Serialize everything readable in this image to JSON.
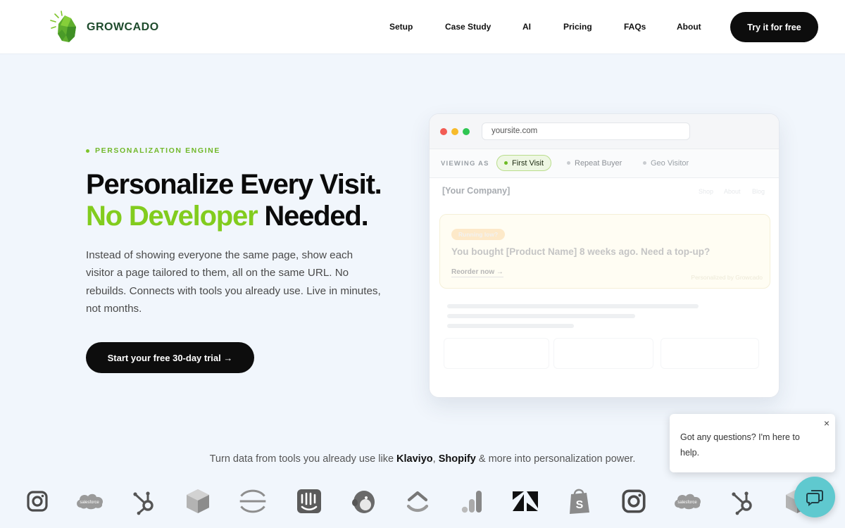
{
  "brand": {
    "name": "GROWCADO"
  },
  "nav": {
    "items": [
      "Setup",
      "Case Study",
      "AI",
      "Pricing",
      "FAQs",
      "About"
    ],
    "cta": "Try it for free"
  },
  "hero": {
    "eyebrow": "PERSONALIZATION ENGINE",
    "title_line1": "Personalize Every Visit.",
    "title_highlight": "No Developer",
    "title_rest": "Needed.",
    "lead": "Instead of showing everyone the same page, show each visitor a page tailored to them, all on the same URL. No rebuilds. Connects with tools you already use. Live in minutes, not months.",
    "cta": "Start your free 30-day trial →"
  },
  "mockup": {
    "url": "yoursite.com",
    "viewing_label": "VIEWING AS",
    "segments": [
      "First Visit",
      "Repeat Buyer",
      "Geo Visitor"
    ],
    "active_segment": "First Visit",
    "company": "[Your Company]",
    "mini_nav": [
      "Shop",
      "About",
      "Blog"
    ],
    "badge": "Running low?",
    "headline": "You bought [Product Name] 8 weeks ago. Need a top-up?",
    "link": "Reorder now →",
    "note": "Personalized by Growcado"
  },
  "integrations": {
    "prefix": "Turn data from tools you already use like",
    "brand1": "Klaviyo",
    "sep": ",",
    "brand2": "Shopify",
    "suffix": "& more into personalization power.",
    "logos": [
      "instagram-logo",
      "salesforce-logo",
      "hubspot-logo",
      "segment-cube-logo",
      "sentry-logo",
      "intercom-logo",
      "mailchimp-logo",
      "clickup-logo",
      "google-analytics-logo",
      "zendesk-logo",
      "shopify-logo",
      "instagram-logo",
      "salesforce-logo",
      "hubspot-logo",
      "segment-cube-logo"
    ]
  },
  "chat": {
    "message": "Got any questions? I'm here to help.",
    "close": "×"
  },
  "colors": {
    "accent_green": "#82cc1e",
    "dark": "#0d0d0d",
    "bg": "#f1f6fc",
    "chat": "#5fc9cf"
  }
}
